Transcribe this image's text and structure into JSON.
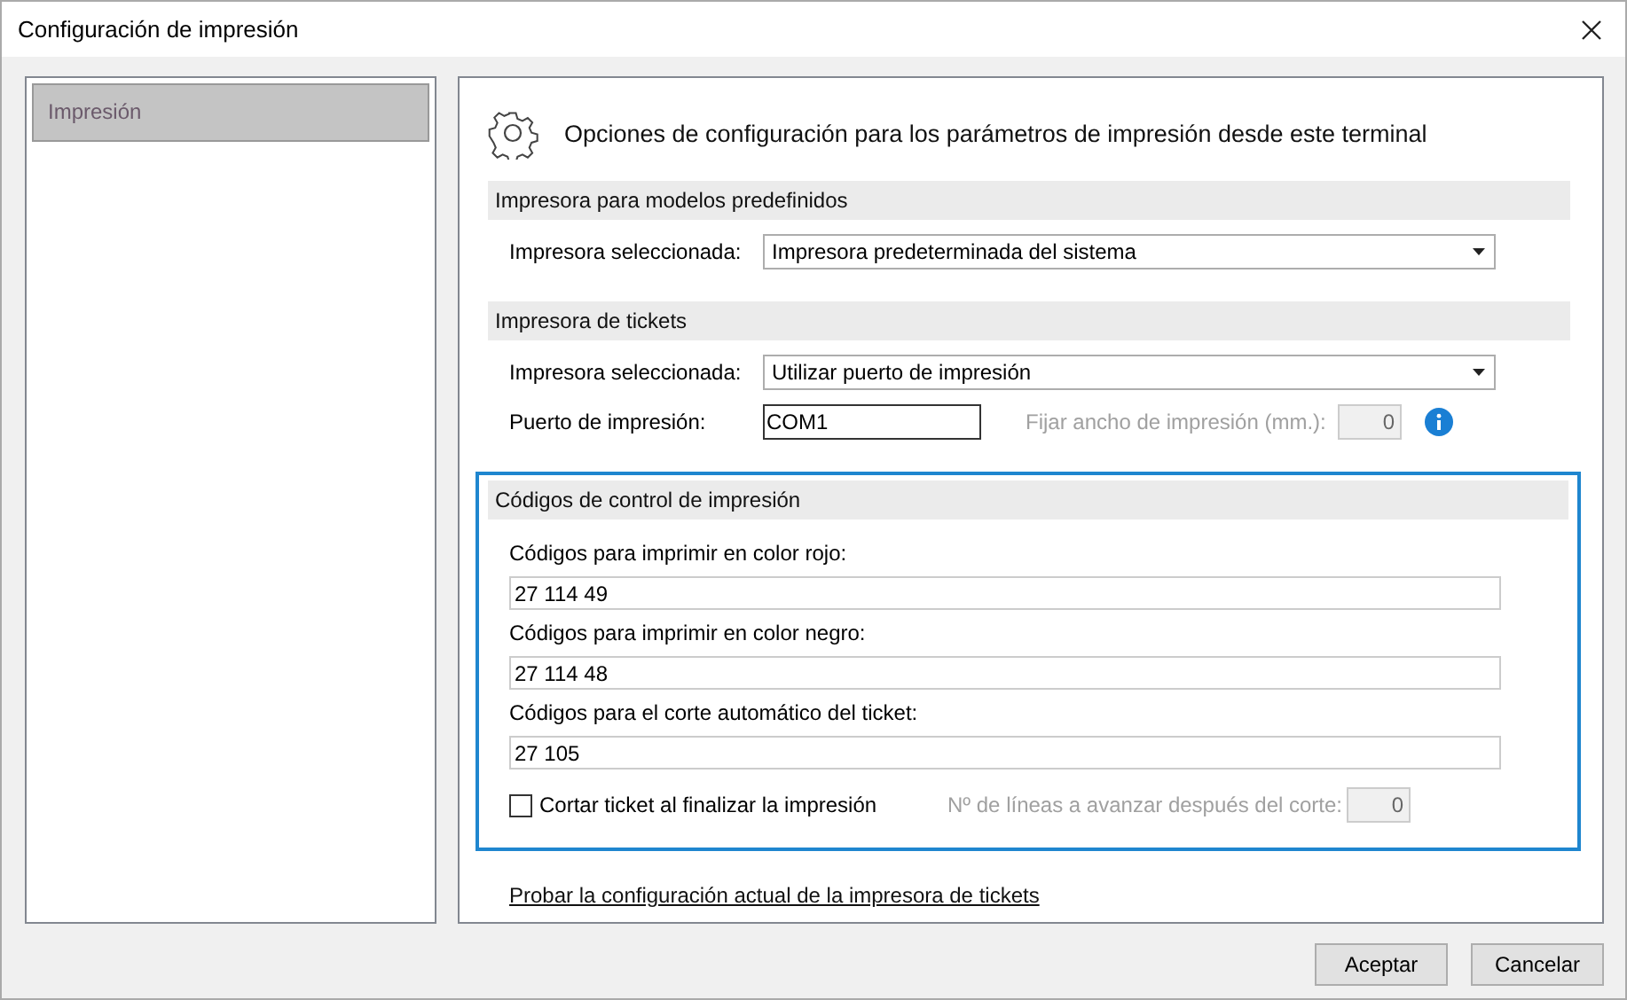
{
  "window": {
    "title": "Configuración de impresión"
  },
  "sidebar": {
    "items": [
      {
        "label": "Impresión",
        "selected": true
      }
    ]
  },
  "panel": {
    "heading": "Opciones de configuración para los parámetros de impresión desde este terminal"
  },
  "sections": [
    {
      "title": "Impresora para modelos predefinidos",
      "focused": false,
      "rows": [
        {
          "kind": "select",
          "label": "Impresora seleccionada:",
          "value": "Impresora predeterminada del sistema"
        }
      ]
    },
    {
      "title": "Impresora de tickets",
      "focused": false,
      "rows": [
        {
          "kind": "select",
          "label": "Impresora seleccionada:",
          "value": "Utilizar puerto de impresión"
        },
        {
          "kind": "port",
          "label": "Puerto de impresión:",
          "value": "COM1",
          "extra_label": "Fijar ancho de impresión (mm.):",
          "extra_value": "0",
          "extra_disabled": true
        }
      ]
    },
    {
      "title": "Códigos de control de impresión",
      "focused": true,
      "rows": [
        {
          "kind": "code",
          "label": "Códigos para imprimir en color rojo:",
          "value": "27 114 49"
        },
        {
          "kind": "code",
          "label": "Códigos para imprimir en color negro:",
          "value": "27 114 48"
        },
        {
          "kind": "code",
          "label": "Códigos para el corte automático del ticket:",
          "value": "27 105"
        },
        {
          "kind": "check",
          "label": "Cortar ticket al finalizar la impresión",
          "checked": false,
          "extra_label": "Nº de líneas a avanzar después del corte:",
          "extra_value": "0",
          "extra_disabled": true
        }
      ]
    }
  ],
  "link": "Probar la configuración actual de la impresora de tickets",
  "buttons": [
    "Aceptar",
    "Cancelar"
  ]
}
